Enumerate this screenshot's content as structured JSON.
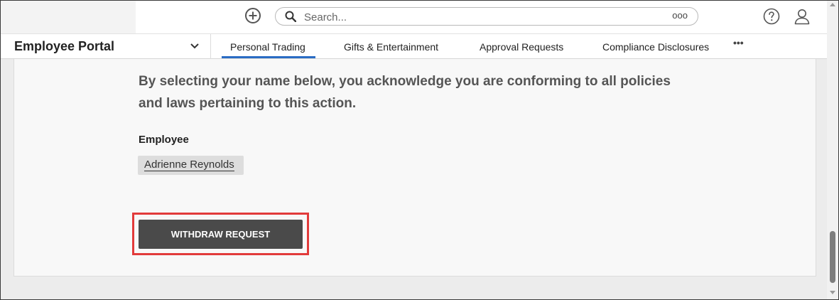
{
  "header": {
    "search_placeholder": "Search...",
    "search_more": "ooo",
    "icons": {
      "add": "plus-circle-icon",
      "search": "search-icon",
      "help": "help-circle-icon",
      "user": "user-icon"
    }
  },
  "nav": {
    "portal_title": "Employee Portal",
    "tabs": [
      {
        "label": "Personal Trading",
        "active": true
      },
      {
        "label": "Gifts & Entertainment",
        "active": false
      },
      {
        "label": "Approval Requests",
        "active": false
      },
      {
        "label": "Compliance Disclosures",
        "active": false
      }
    ],
    "more": "•••"
  },
  "content": {
    "acknowledgement": "By selecting your name below, you acknowledge you are conforming to all policies and laws pertaining to this action.",
    "employee_label": "Employee",
    "employee_name": "Adrienne Reynolds",
    "withdraw_label": "WITHDRAW REQUEST"
  },
  "colors": {
    "accent": "#2a6cc4",
    "button": "#4a4a4a",
    "highlight": "#e23b3b"
  }
}
